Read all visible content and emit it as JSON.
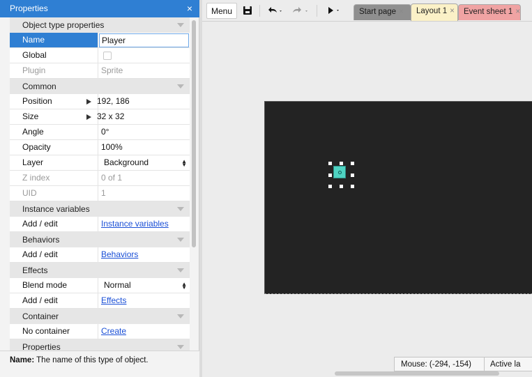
{
  "properties_panel": {
    "title": "Properties",
    "close_icon": "close-icon",
    "sections": {
      "object_type": "Object type properties",
      "common": "Common",
      "instance_variables": "Instance variables",
      "behaviors": "Behaviors",
      "effects": "Effects",
      "container": "Container",
      "properties_cutoff": "Properties"
    },
    "rows": {
      "name": {
        "label": "Name",
        "value": "Player"
      },
      "global": {
        "label": "Global",
        "checked": false
      },
      "plugin": {
        "label": "Plugin",
        "value": "Sprite"
      },
      "position": {
        "label": "Position",
        "value": "192, 186"
      },
      "size": {
        "label": "Size",
        "value": "32 x 32"
      },
      "angle": {
        "label": "Angle",
        "value": "0°"
      },
      "opacity": {
        "label": "Opacity",
        "value": "100%"
      },
      "layer": {
        "label": "Layer",
        "value": "Background"
      },
      "z_index": {
        "label": "Z index",
        "value": "0 of 1"
      },
      "uid": {
        "label": "UID",
        "value": "1"
      },
      "instance_vars_edit": {
        "label": "Add / edit",
        "link": "Instance variables"
      },
      "behaviors_edit": {
        "label": "Add / edit",
        "link": "Behaviors"
      },
      "blend_mode": {
        "label": "Blend mode",
        "value": "Normal"
      },
      "effects_edit": {
        "label": "Add / edit",
        "link": "Effects"
      },
      "container": {
        "label": "No container",
        "link": "Create"
      }
    },
    "description": {
      "label": "Name:",
      "text": "The name of this type of object."
    }
  },
  "toolbar": {
    "menu_label": "Menu",
    "save_icon": "save-icon",
    "undo_icon": "undo-icon",
    "redo_icon": "redo-icon",
    "run_icon": "play-icon",
    "dropdown_glyph": "▾"
  },
  "tabs": [
    {
      "label": "Start page",
      "close": "×"
    },
    {
      "label": "Layout 1",
      "close": "×"
    },
    {
      "label": "Event sheet 1",
      "close": "×"
    }
  ],
  "statusbar": {
    "mouse": "Mouse: (-294, -154)",
    "active_layer": "Active la"
  },
  "colors": {
    "accent": "#2f7fd3",
    "layout_background": "#232323",
    "sprite": "#4fd3c2",
    "tab_layout": "#fbf1c7",
    "tab_event": "#f0a3a3",
    "link": "#1a4fd6"
  }
}
